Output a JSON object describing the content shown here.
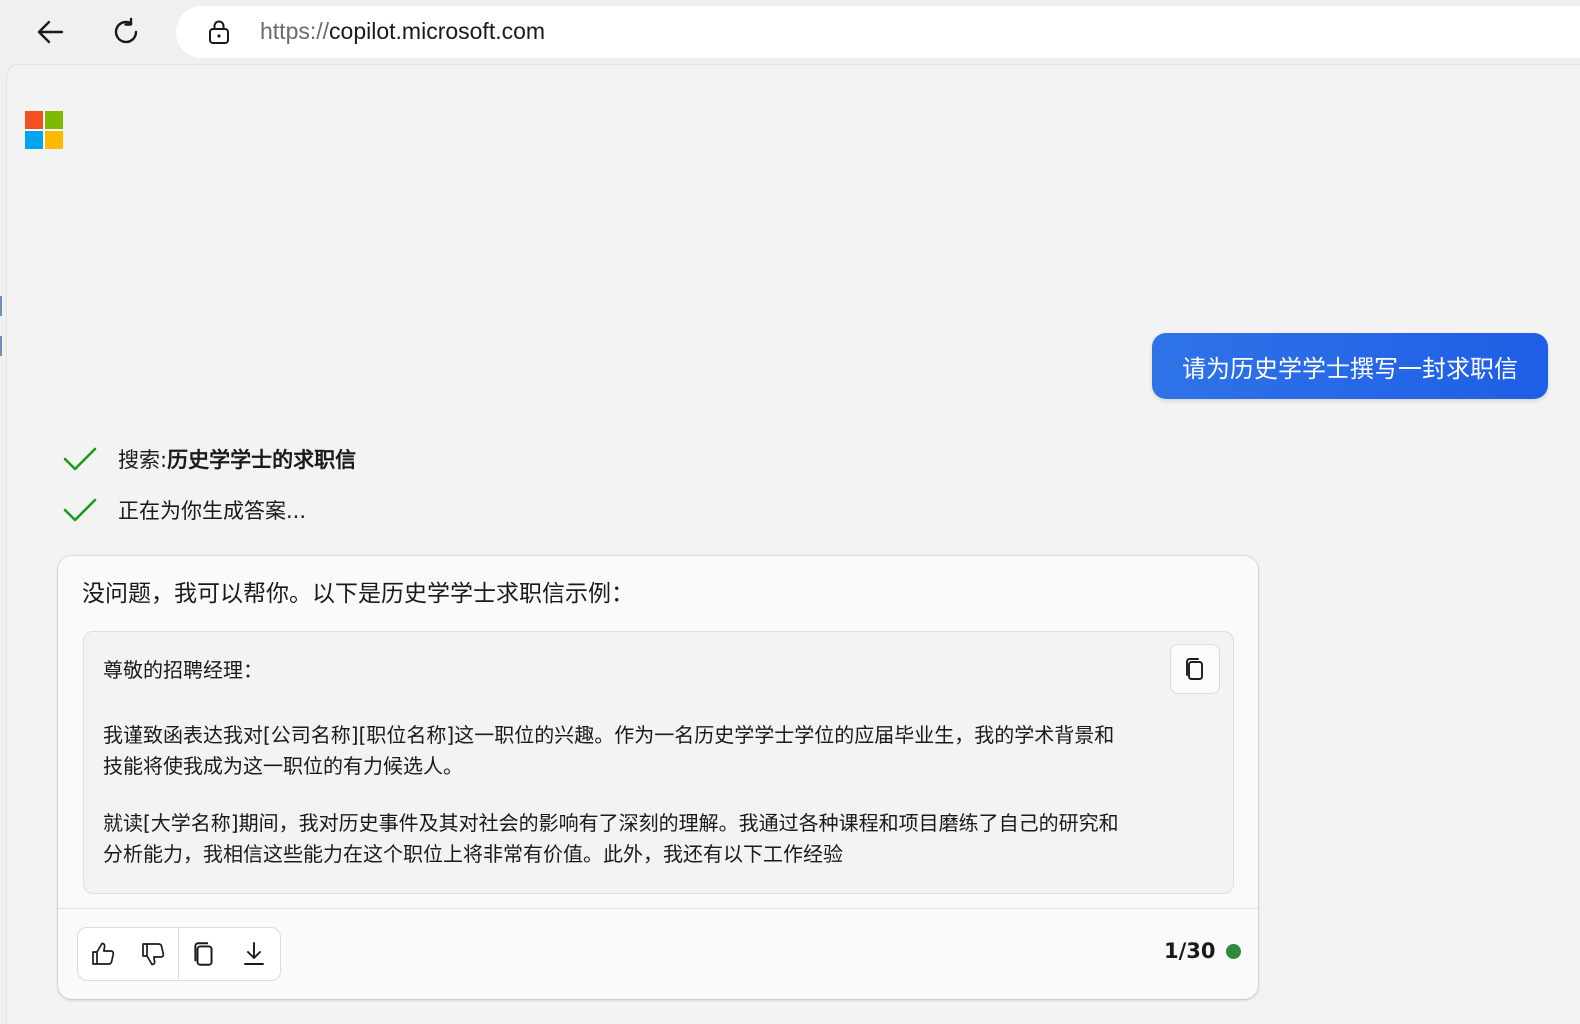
{
  "browser": {
    "url_protocol": "https://",
    "url_host": "copilot.microsoft.com",
    "back_icon": "arrow-left-icon",
    "reload_icon": "reload-icon",
    "lock_icon": "lock-icon"
  },
  "brand": {
    "logo": "microsoft-logo",
    "colors": [
      "#f25022",
      "#7fba00",
      "#00a4ef",
      "#ffb900"
    ]
  },
  "chat": {
    "user_message": "请为历史学学士撰写一封求职信",
    "status": {
      "search_prefix": "搜索:",
      "search_query": "历史学学士的求职信",
      "generating": "正在为你生成答案..."
    },
    "answer": {
      "intro": "没问题，我可以帮你。以下是历史学学士求职信示例：",
      "letter": {
        "salutation": "尊敬的招聘经理：",
        "p1_line1": "我谨致函表达我对[公司名称][职位名称]这一职位的兴趣。作为一名历史学学士学位的应届毕业生，我的学术背景和",
        "p1_line2": "技能将使我成为这一职位的有力候选人。",
        "p2_line1": "就读[大学名称]期间，我对历史事件及其对社会的影响有了深刻的理解。我通过各种课程和项目磨练了自己的研究和",
        "p2_line2": "分析能力，我相信这些能力在这个职位上将非常有价值。此外，我还有以下工作经验"
      },
      "actions": [
        "thumbs-up-icon",
        "thumbs-down-icon",
        "copy-icon",
        "download-icon"
      ],
      "counter": "1/30"
    }
  },
  "colors": {
    "accent": "#2563eb",
    "check": "#1a9b1a",
    "status_dot": "#2e8b3e"
  }
}
